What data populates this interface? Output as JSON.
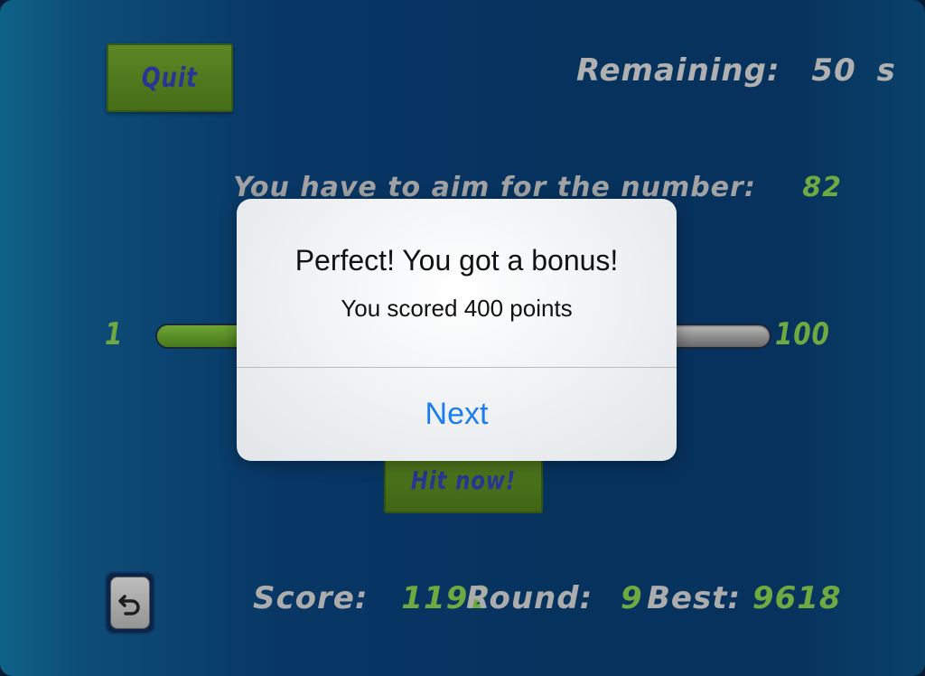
{
  "game": {
    "quit_label": "Quit",
    "remaining_label": "Remaining:",
    "remaining_value": "50",
    "remaining_unit": "s",
    "aim_label": "You have to aim for the number:",
    "aim_target": "82",
    "range_min": "1",
    "range_max": "100",
    "slider_level_percent": 17,
    "hit_label": "Hit now!",
    "score_label": "Score:",
    "score_value": "1192",
    "round_label": "Round:",
    "round_value": "9",
    "best_label": "Best:",
    "best_value": "9618",
    "undo_icon": "undo-arrow-icon"
  },
  "alert": {
    "title": "Perfect! You got a bonus!",
    "message": "You scored 400 points",
    "button_label": "Next"
  },
  "colors": {
    "accent_green": "#7fc24a",
    "button_green": "#5f8f25",
    "button_text_blue": "#2d3ea8",
    "ios_blue": "#1a7df0"
  }
}
